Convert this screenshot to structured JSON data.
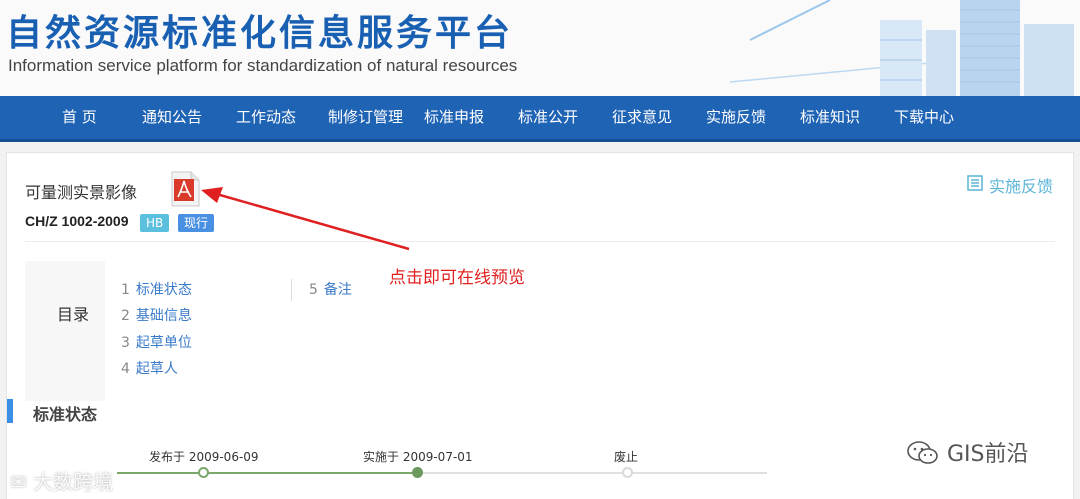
{
  "header": {
    "title": "自然资源标准化信息服务平台",
    "subtitle": "Information service platform for standardization of natural resources"
  },
  "nav": {
    "items": [
      {
        "label": "首 页"
      },
      {
        "label": "通知公告"
      },
      {
        "label": "工作动态"
      },
      {
        "label": "制修订管理"
      },
      {
        "label": "标准申报"
      },
      {
        "label": "标准公开"
      },
      {
        "label": "征求意见"
      },
      {
        "label": "实施反馈"
      },
      {
        "label": "标准知识"
      },
      {
        "label": "下载中心"
      }
    ]
  },
  "standard": {
    "title": "可量测实景影像",
    "code": "CH/Z 1002-2009",
    "badge_type": "HB",
    "badge_status": "现行",
    "feedback_label": "实施反馈"
  },
  "toc": {
    "label": "目录",
    "items": [
      {
        "num": "1",
        "label": "标准状态"
      },
      {
        "num": "2",
        "label": "基础信息"
      },
      {
        "num": "3",
        "label": "起草单位"
      },
      {
        "num": "4",
        "label": "起草人"
      },
      {
        "num": "5",
        "label": "备注"
      }
    ]
  },
  "annotation": {
    "text": "点击即可在线预览"
  },
  "status_section": {
    "title": "标准状态",
    "timeline": [
      {
        "label": "发布于 2009-06-09",
        "state": "done"
      },
      {
        "label": "实施于 2009-07-01",
        "state": "current"
      },
      {
        "label": "废止",
        "state": "todo"
      }
    ]
  },
  "watermarks": {
    "left": "大数跨境",
    "right": "GIS前沿"
  },
  "colors": {
    "brand_blue": "#1f63b5",
    "title_blue": "#1960b3",
    "link_blue": "#3a7bc8",
    "annotation_red": "#e02020",
    "timeline_green": "#7aa86b"
  }
}
